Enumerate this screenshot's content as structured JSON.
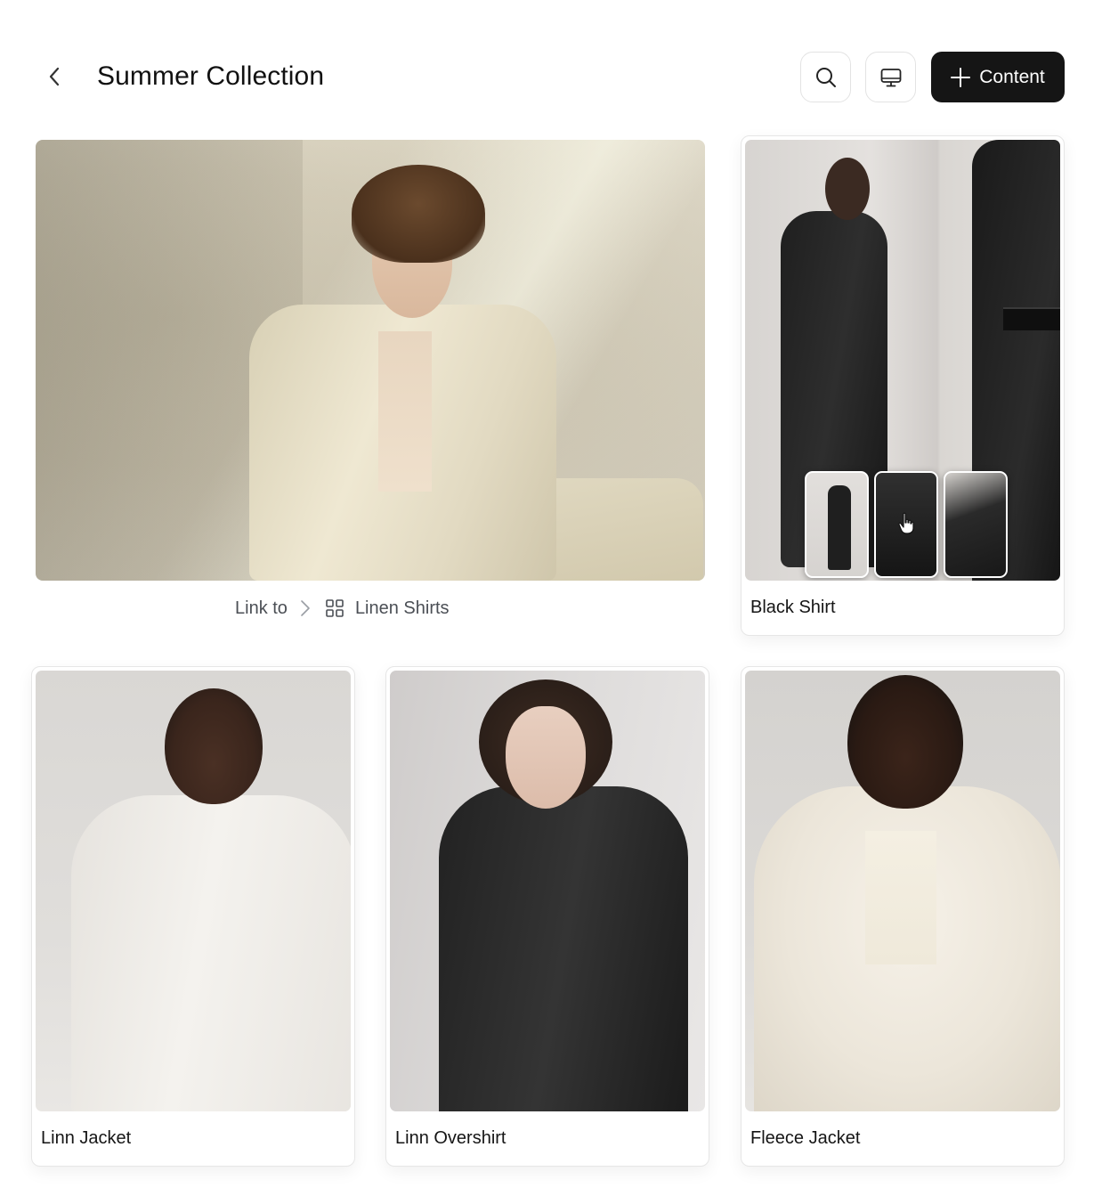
{
  "header": {
    "title": "Summer Collection",
    "content_button_label": "Content"
  },
  "icons": {
    "back": "chevron-left-icon",
    "search": "search-icon",
    "device": "monitor-icon",
    "add": "plus-icon",
    "link_separator": "chevron-right-icon",
    "collection": "grid-icon",
    "cursor": "hand-pointer-icon"
  },
  "hero": {
    "link_label": "Link to",
    "link_target": "Linen Shirts"
  },
  "cards": [
    {
      "label": "Black Shirt",
      "thumbnail_count": 3
    },
    {
      "label": "Linn Jacket"
    },
    {
      "label": "Linn Overshirt"
    },
    {
      "label": "Fleece Jacket"
    }
  ],
  "colors": {
    "primary_button": "#151515",
    "border": "#e6e6e6",
    "muted_text": "#4b4f55"
  }
}
